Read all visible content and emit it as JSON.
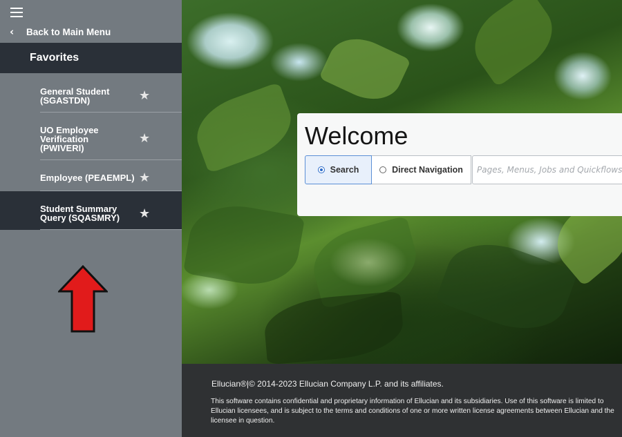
{
  "sidebar": {
    "menu_icon": "hamburger-icon",
    "back_icon": "chevron-left-icon",
    "back_label": "Back to Main Menu",
    "favorites_header": "Favorites",
    "items": [
      {
        "line1": "General Student",
        "line2": "(SGASTDN)",
        "line3": "",
        "star_icon": "star-icon"
      },
      {
        "line1": "UO Employee",
        "line2": "Verification",
        "line3": "(PWIVERI)",
        "star_icon": "star-icon"
      },
      {
        "line1": "Employee (PEAEMPL)",
        "line2": "",
        "line3": "",
        "star_icon": "star-icon"
      },
      {
        "line1": "Student Summary",
        "line2": "Query (SQASMRY)",
        "line3": "",
        "star_icon": "star-icon",
        "active": true
      }
    ],
    "star_glyph": "★"
  },
  "annotation": {
    "arrow_color": "#e11b1b",
    "arrow_direction": "up"
  },
  "welcome": {
    "title": "Welcome",
    "tabs": [
      {
        "label": "Search",
        "selected": true
      },
      {
        "label": "Direct Navigation",
        "selected": false
      }
    ],
    "search_placeholder": "Pages, Menus, Jobs and Quickflows",
    "search_value": ""
  },
  "footer": {
    "copyright": "Ellucian®|© 2014-2023 Ellucian Company L.P. and its affiliates.",
    "disclaimer_lines": [
      "This software contains confidential and proprietary information of Ellucian and its subsidiaries. Use of this software is limited to",
      "Ellucian licensees, and is subject to the terms and conditions of one or more written license agreements between Ellucian and the",
      "licensee in question."
    ]
  },
  "colors": {
    "sidebar_bg": "#737a80",
    "sidebar_header_bg": "#2a3038",
    "footer_bg": "#2f3133",
    "accent_blue": "#2b6bc9"
  }
}
